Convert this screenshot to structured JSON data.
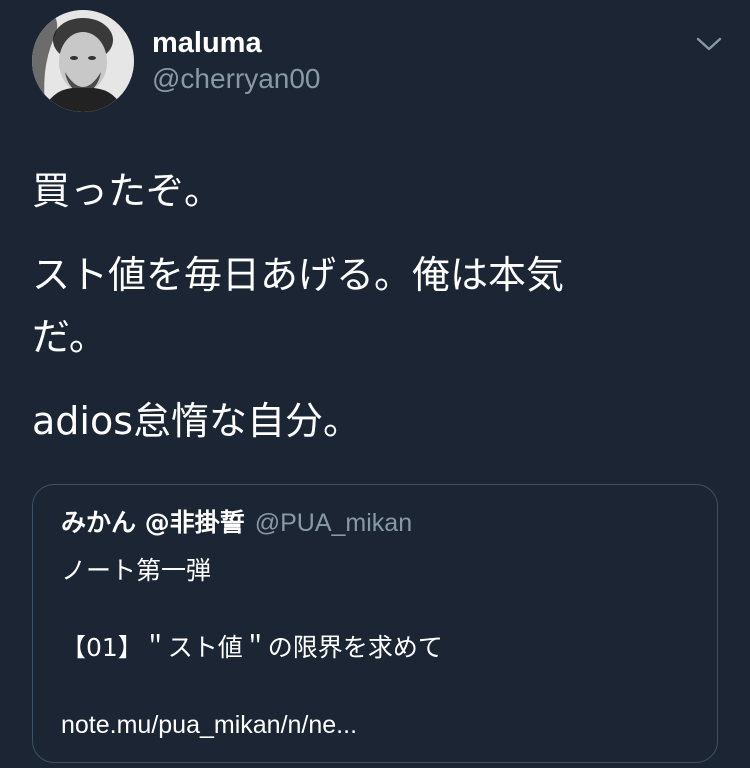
{
  "author": {
    "display_name": "maluma",
    "handle": "@cherryan00"
  },
  "icons": {
    "menu": "chevron-down-icon",
    "avatar": "profile-photo"
  },
  "tweet": {
    "lines": [
      "買ったぞ。",
      "スト値を毎日あげる。俺は本気\nだ。",
      "adios怠惰な自分。"
    ]
  },
  "quoted_tweet": {
    "display_name": "みかん @非掛誓",
    "handle": "@PUA_mikan",
    "title": "ノート第一弾",
    "subtitle": "【01】＂スト値＂の限界を求めて",
    "link": "note.mu/pua_mikan/n/ne..."
  },
  "colors": {
    "background": "#1b2533",
    "text": "#ffffff",
    "muted": "#8899a6",
    "border": "#3d5266"
  }
}
